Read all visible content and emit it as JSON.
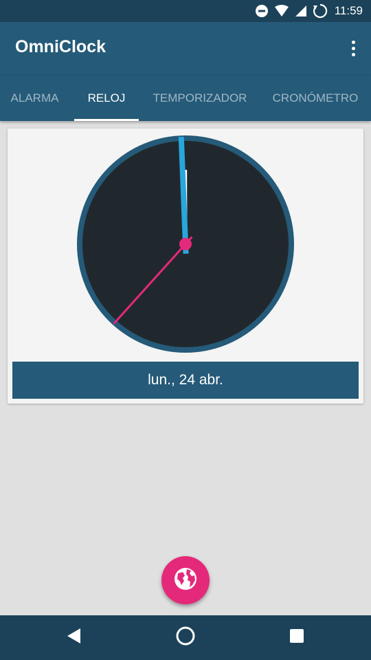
{
  "status_bar": {
    "time": "11:59",
    "icons": [
      "do-not-disturb-icon",
      "wifi-icon",
      "signal-icon",
      "sync-icon"
    ]
  },
  "app_bar": {
    "title": "OmniClock",
    "overflow_icon": "more-vert-icon"
  },
  "tabs": [
    {
      "label": "ALARMA",
      "active": false
    },
    {
      "label": "RELOJ",
      "active": true
    },
    {
      "label": "TEMPORIZADOR",
      "active": false
    },
    {
      "label": "CRONÓMETRO",
      "active": false
    }
  ],
  "clock": {
    "hours": 11,
    "minutes": 59,
    "seconds": 37,
    "face_color": "#21282d",
    "rim_color": "#255a78",
    "minute_hand_color": "#29a6dc",
    "second_hand_color": "#e5297a",
    "hour_hand_color": "#ffffff"
  },
  "date": "lun., 24 abr.",
  "fab": {
    "icon": "globe-icon",
    "color": "#e5297a"
  },
  "nav": {
    "back_icon": "back-icon",
    "home_icon": "home-icon",
    "recents_icon": "recents-icon"
  },
  "colors": {
    "primary": "#255a78",
    "primary_dark": "#1b4258",
    "accent": "#e5297a"
  }
}
